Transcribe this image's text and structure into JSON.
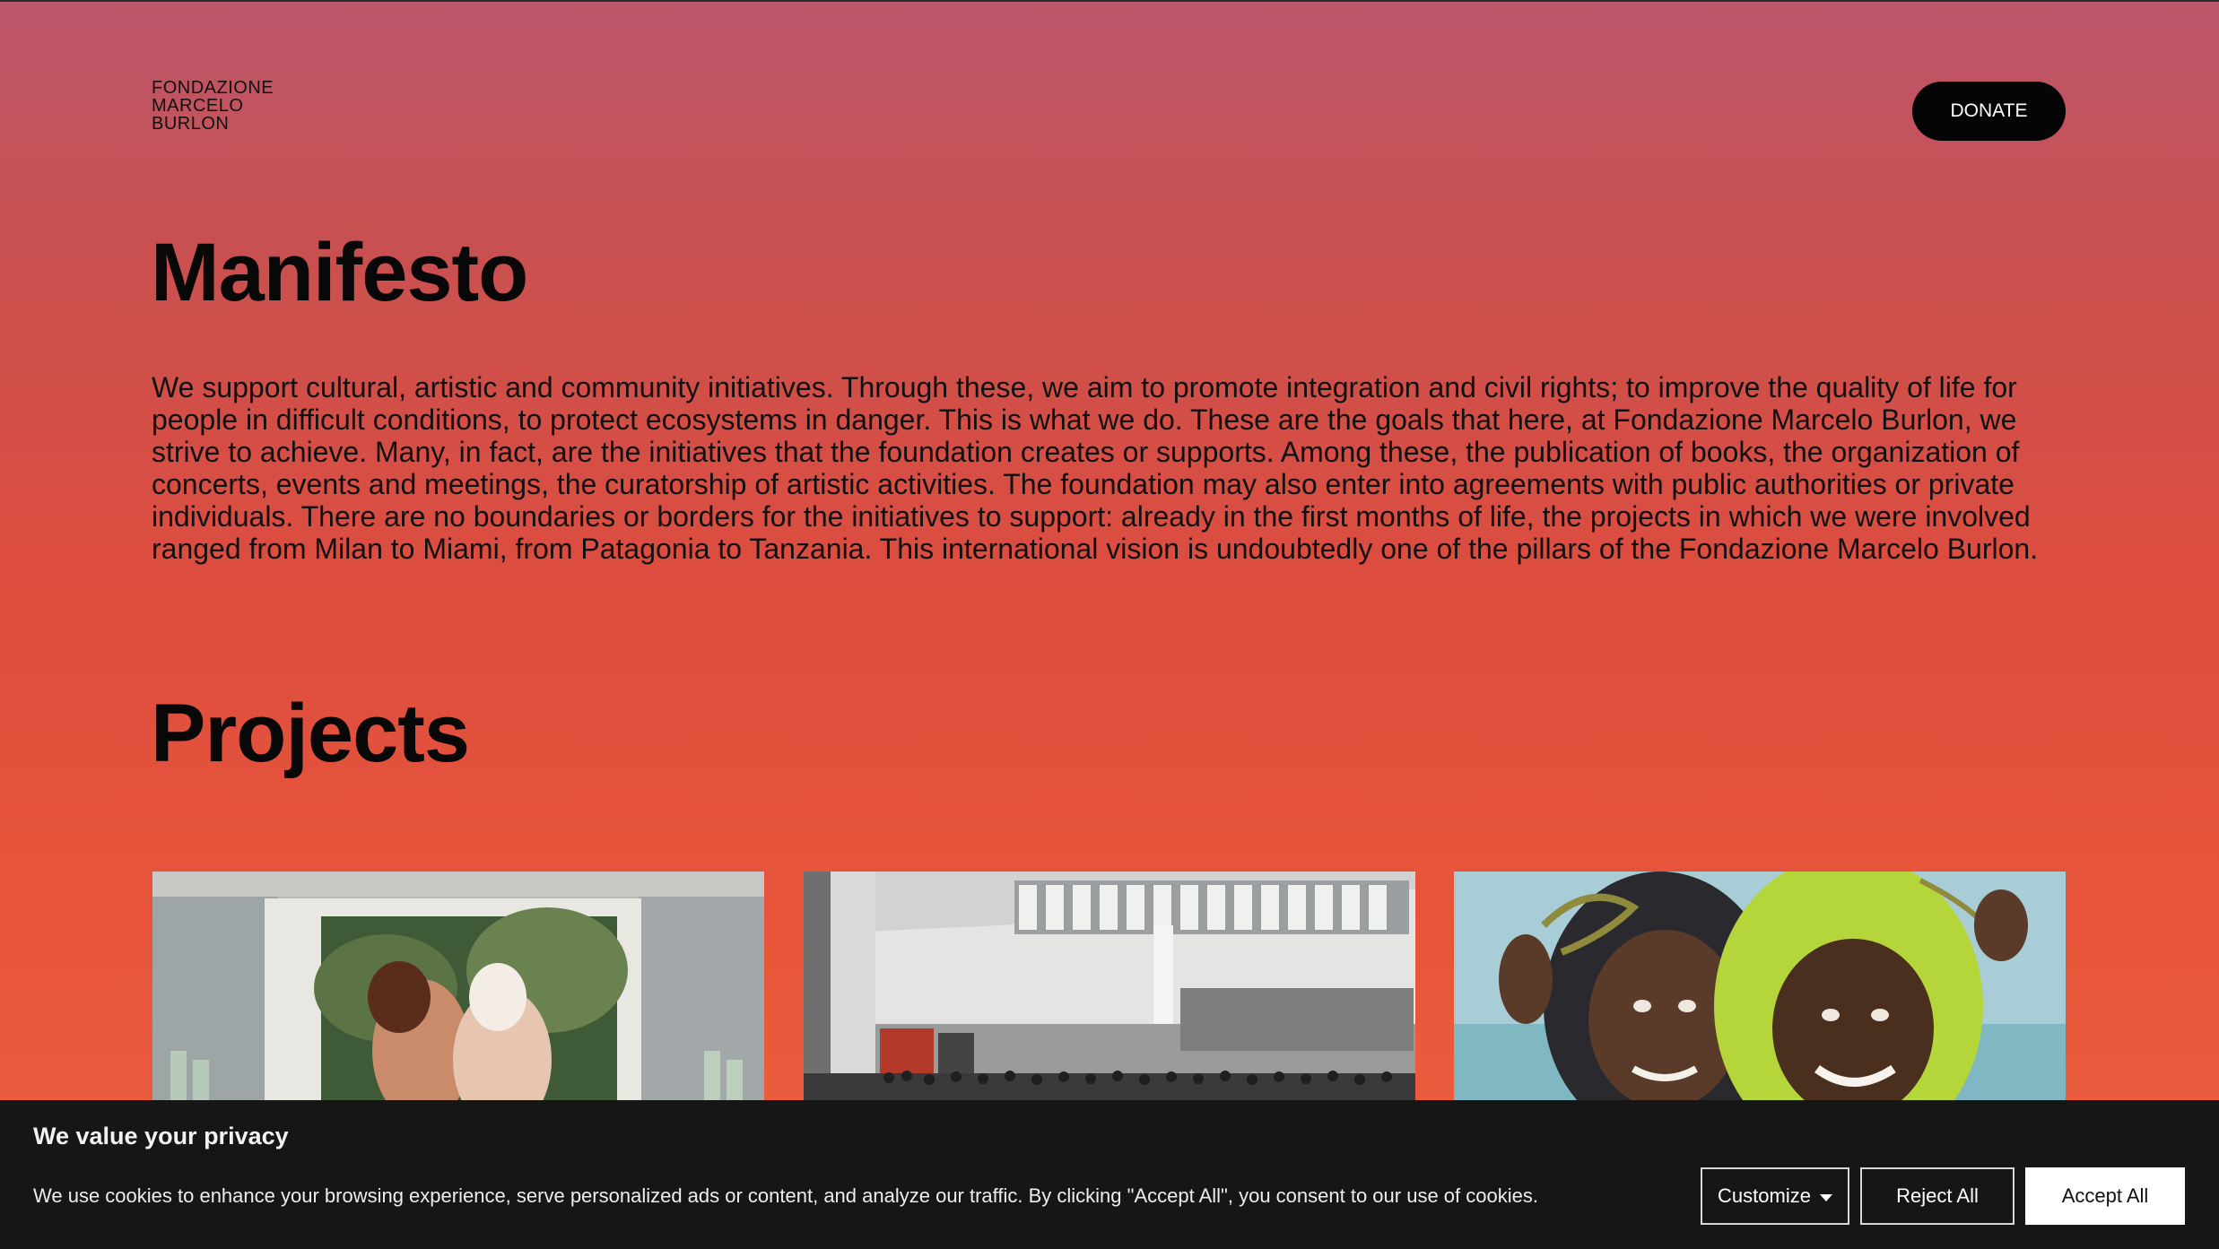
{
  "header": {
    "logo_lines": [
      "FONDAZIONE",
      "MARCELO",
      "BURLON"
    ],
    "donate_label": "DONATE"
  },
  "manifesto": {
    "title": "Manifesto",
    "body": "We support cultural, artistic and community initiatives. Through these, we aim to promote integration and civil rights; to improve the quality of life for people in difficult conditions, to protect ecosystems in danger. This is what we do. These are the goals that here, at Fondazione Marcelo Burlon, we strive to achieve. Many, in fact, are the initiatives that the foundation creates or supports. Among these, the publication of books, the organization of concerts, events and meetings, the curatorship of artistic activities. The foundation may also enter into agreements with public authorities or private individuals. There are no boundaries or borders for the initiatives to support: already in the first months of life, the projects in which we were involved ranged from Milan to Miami, from Patagonia to Tanzania. This international vision is undoubtedly one of the pillars of the Fondazione Marcelo Burlon."
  },
  "projects": {
    "title": "Projects",
    "cards": [
      {
        "image": "exhibition-photo-embracing-figures"
      },
      {
        "image": "gallery-hall-crowd"
      },
      {
        "image": "smiling-children-headscarves"
      }
    ]
  },
  "cookie": {
    "title": "We value your privacy",
    "text": "We use cookies to enhance your browsing experience, serve personalized ads or content, and analyze our traffic. By clicking \"Accept All\", you consent to our use of cookies.",
    "customize_label": "Customize",
    "reject_label": "Reject All",
    "accept_label": "Accept All"
  }
}
